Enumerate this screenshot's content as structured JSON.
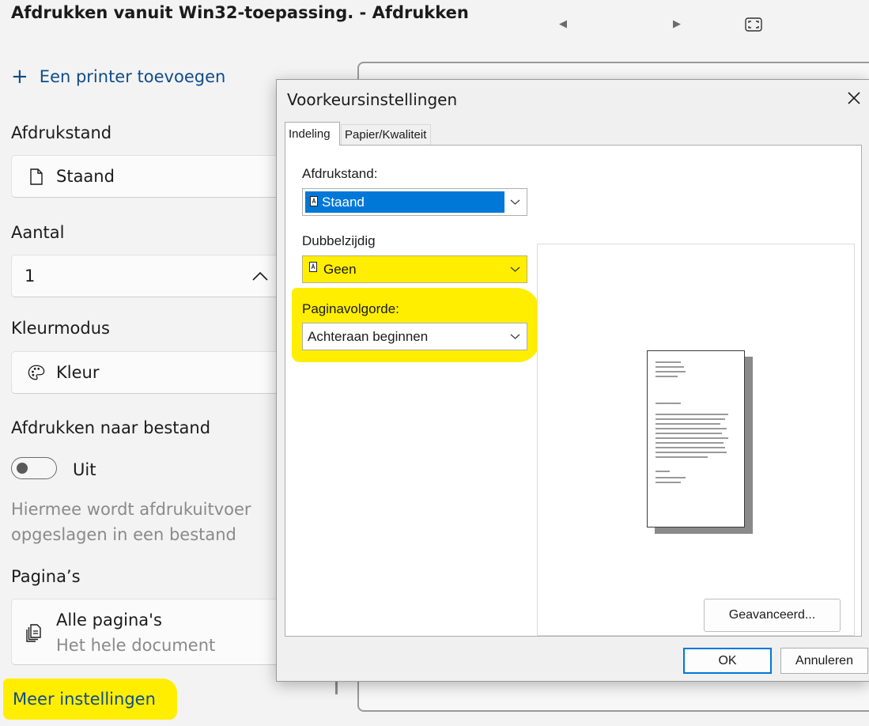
{
  "window": {
    "title": "Afdrukken vanuit Win32-toepassing. - Afdrukken",
    "prev_icon": "triangle-left-icon",
    "next_icon": "triangle-right-icon",
    "fit_icon": "fit-to-window-icon"
  },
  "print_panel": {
    "add_printer": {
      "plus": "+",
      "label": "Een printer toevoegen"
    },
    "orientation": {
      "label": "Afdrukstand",
      "value": "Staand",
      "icon": "document-icon"
    },
    "copies": {
      "label": "Aantal",
      "value": "1",
      "icon": "chevron-up-icon"
    },
    "color_mode": {
      "label": "Kleurmodus",
      "value": "Kleur",
      "icon": "palette-icon"
    },
    "print_to_file": {
      "label": "Afdrukken naar bestand",
      "state": "Uit",
      "description": "Hiermee wordt afdrukuitvoer opgeslagen in een bestand"
    },
    "pages": {
      "label": "Pagina’s",
      "value": "Alle pagina's",
      "sub": "Het hele document",
      "icon": "pages-stack-icon"
    },
    "more_settings": "Meer instellingen"
  },
  "dialog": {
    "title": "Voorkeursinstellingen",
    "close_icon": "close-icon",
    "tabs": [
      {
        "label": "Indeling",
        "active": true
      },
      {
        "label": "Papier/Kwaliteit",
        "active": false
      }
    ],
    "orientation": {
      "label": "Afdrukstand:",
      "value": "Staand"
    },
    "duplex": {
      "label": "Dubbelzijdig",
      "value": "Geen"
    },
    "page_order": {
      "label": "Paginavolgorde:",
      "value": "Achteraan beginnen"
    },
    "advanced_button": "Geavanceerd...",
    "ok_button": "OK",
    "cancel_button": "Annuleren"
  },
  "colors": {
    "highlight": "#ffee00",
    "link": "#0f4c8a",
    "selection": "#0078d7"
  }
}
